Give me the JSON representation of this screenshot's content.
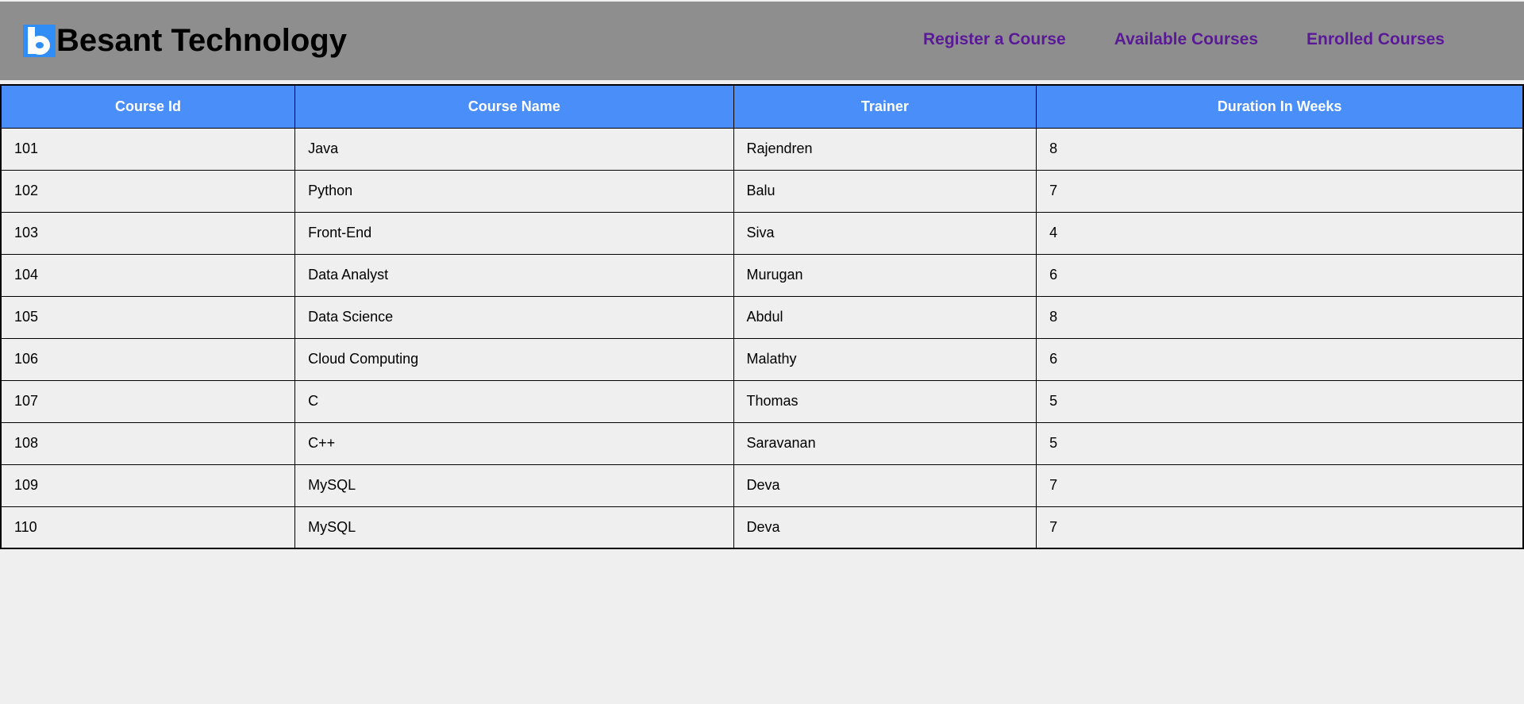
{
  "brand": {
    "name": "Besant Technology",
    "logo_letter": "b",
    "logo_color": "#2f8df5"
  },
  "nav": {
    "links": [
      "Register a Course",
      "Available Courses",
      "Enrolled Courses"
    ],
    "link_color": "#5a1a96"
  },
  "colors": {
    "header_bg": "#8f8e8f",
    "table_header_bg": "#4a8ef9",
    "page_bg": "#efefef"
  },
  "table": {
    "headers": [
      "Course Id",
      "Course Name",
      "Trainer",
      "Duration In Weeks"
    ],
    "rows": [
      [
        "101",
        "Java",
        "Rajendren",
        "8"
      ],
      [
        "102",
        "Python",
        "Balu",
        "7"
      ],
      [
        "103",
        "Front-End",
        "Siva",
        "4"
      ],
      [
        "104",
        "Data Analyst",
        "Murugan",
        "6"
      ],
      [
        "105",
        "Data Science",
        "Abdul",
        "8"
      ],
      [
        "106",
        "Cloud Computing",
        "Malathy",
        "6"
      ],
      [
        "107",
        "C",
        "Thomas",
        "5"
      ],
      [
        "108",
        "C++",
        "Saravanan",
        "5"
      ],
      [
        "109",
        "MySQL",
        "Deva",
        "7"
      ],
      [
        "110",
        "MySQL",
        "Deva",
        "7"
      ]
    ]
  }
}
